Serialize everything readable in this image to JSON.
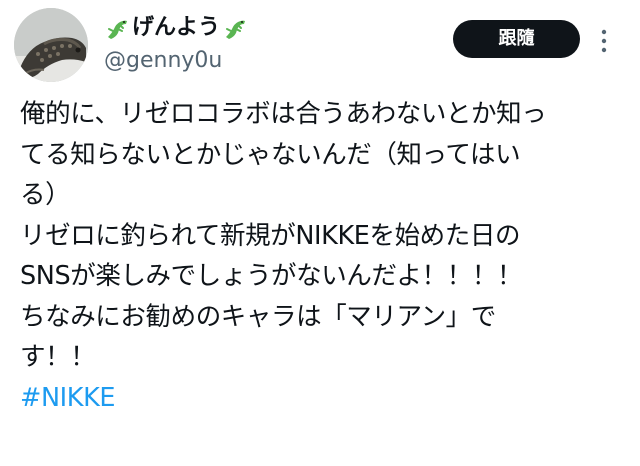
{
  "tweet": {
    "author": {
      "name": "げんよう",
      "handle": "@genny0u",
      "name_emoji_left": "lizard-icon",
      "name_emoji_right": "lizard-icon"
    },
    "follow_label": "跟隨",
    "lines": [
      "俺的に、リゼロコラボは合うあわないとか知っ",
      "てる知らないとかじゃないんだ（知ってはい",
      "る）",
      "リゼロに釣られて新規がNIKKEを始めた日の",
      "SNSが楽しみでしょうがないんだよ！！！！",
      "ちなみにお勧めのキャラは「マリアン」で",
      "す！！"
    ],
    "hashtag": "#NIKKE"
  },
  "colors": {
    "text": "#0f1419",
    "secondary": "#536471",
    "link": "#1d9bf0",
    "button_bg": "#0f1419",
    "button_text": "#ffffff",
    "emoji_green": "#5ab552"
  }
}
